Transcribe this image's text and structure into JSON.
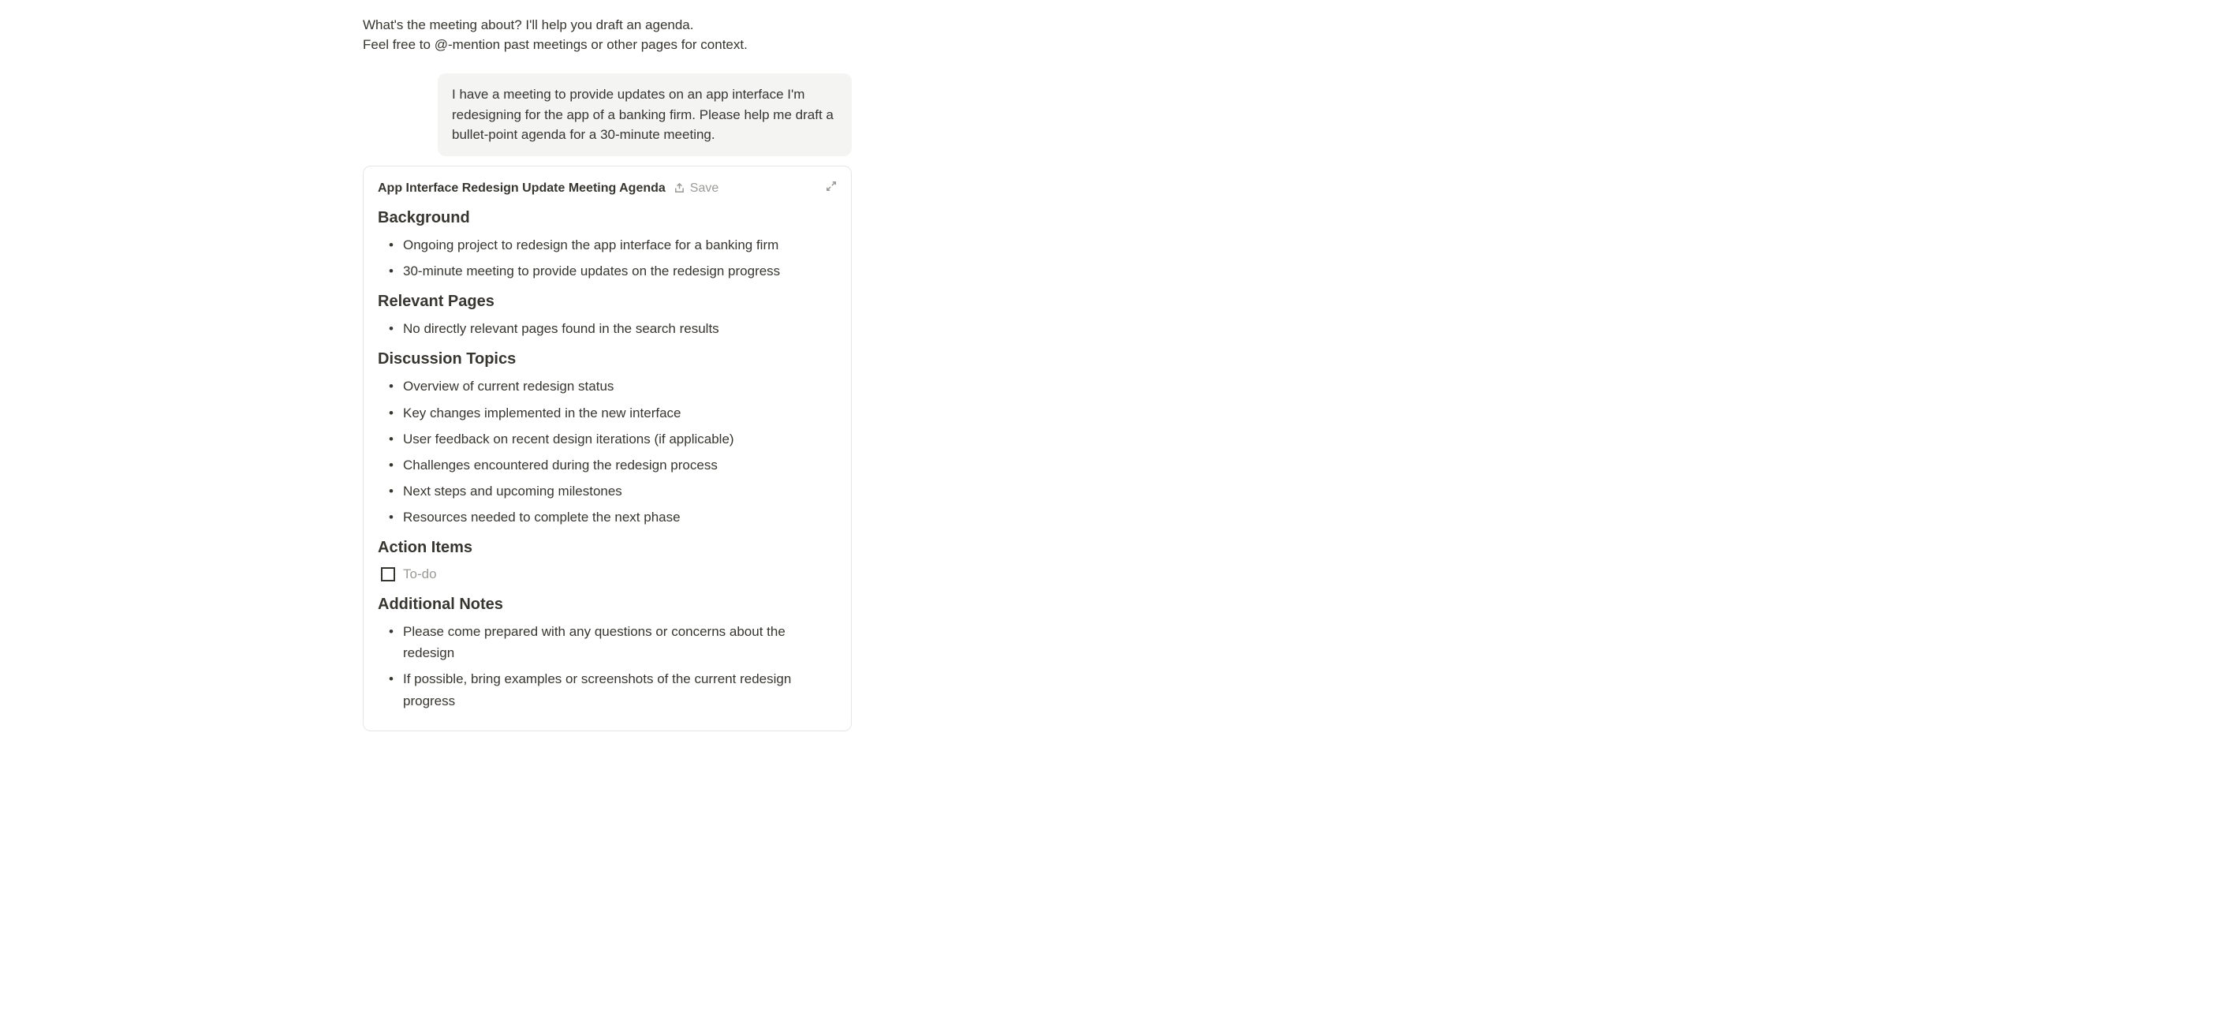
{
  "assistant": {
    "intro_line1": "What's the meeting about? I'll help you draft an agenda.",
    "intro_line2": "Feel free to @-mention past meetings or other pages for context."
  },
  "user_message": "I have a meeting to provide updates on an app interface I'm redesigning for the app of a banking firm. Please help me draft a bullet-point agenda for a 30-minute meeting.",
  "card": {
    "title": "App Interface Redesign Update Meeting Agenda",
    "save_label": "Save",
    "sections": {
      "background": {
        "heading": "Background",
        "items": [
          "Ongoing project to redesign the app interface for a banking firm",
          "30-minute meeting to provide updates on the redesign progress"
        ]
      },
      "relevant_pages": {
        "heading": "Relevant Pages",
        "items": [
          "No directly relevant pages found in the search results"
        ]
      },
      "discussion_topics": {
        "heading": "Discussion Topics",
        "items": [
          "Overview of current redesign status",
          "Key changes implemented in the new interface",
          "User feedback on recent design iterations (if applicable)",
          "Challenges encountered during the redesign process",
          "Next steps and upcoming milestones",
          "Resources needed to complete the next phase"
        ]
      },
      "action_items": {
        "heading": "Action Items",
        "todo_label": "To-do"
      },
      "additional_notes": {
        "heading": "Additional Notes",
        "items": [
          "Please come prepared with any questions or concerns about the redesign",
          "If possible, bring examples or screenshots of the current redesign progress"
        ]
      }
    }
  }
}
